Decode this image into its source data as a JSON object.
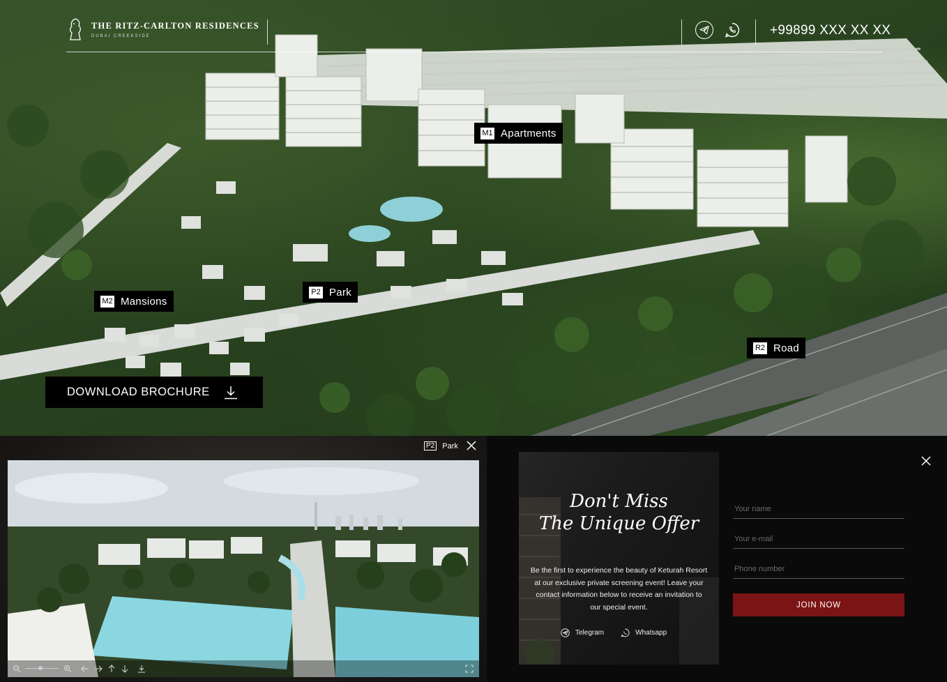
{
  "header": {
    "brand_name": "THE RITZ-CARLTON RESIDENCES",
    "brand_sub": "DUBAI CREEKSIDE",
    "phone": "+99899 XXX XX XX",
    "icons": [
      "telegram-icon",
      "whatsapp-icon"
    ]
  },
  "map_tags": [
    {
      "code": "M1",
      "label": "Apartments"
    },
    {
      "code": "M2",
      "label": "Mansions"
    },
    {
      "code": "P2",
      "label": "Park"
    },
    {
      "code": "R2",
      "label": "Road"
    }
  ],
  "download": {
    "label": "DOWNLOAD BROCHURE"
  },
  "gallery": {
    "tag_code": "P2",
    "tag_label": "Park"
  },
  "offer": {
    "title_line1": "Don't Miss",
    "title_line2": "The Unique Offer",
    "text": "Be the first to experience the beauty of Keturah Resort at our exclusive private screening event! Leave your contact information below to receive an invitation to our special event.",
    "telegram_label": "Telegram",
    "whatsapp_label": "Whatsapp",
    "name_placeholder": "Your name",
    "email_placeholder": "Your e-mail",
    "phone_placeholder": "Phone number",
    "submit_label": "JOIN NOW"
  },
  "colors": {
    "accent_red": "#7b1414",
    "tag_bg": "#000000",
    "panel_bg": "#0a0a0a"
  }
}
